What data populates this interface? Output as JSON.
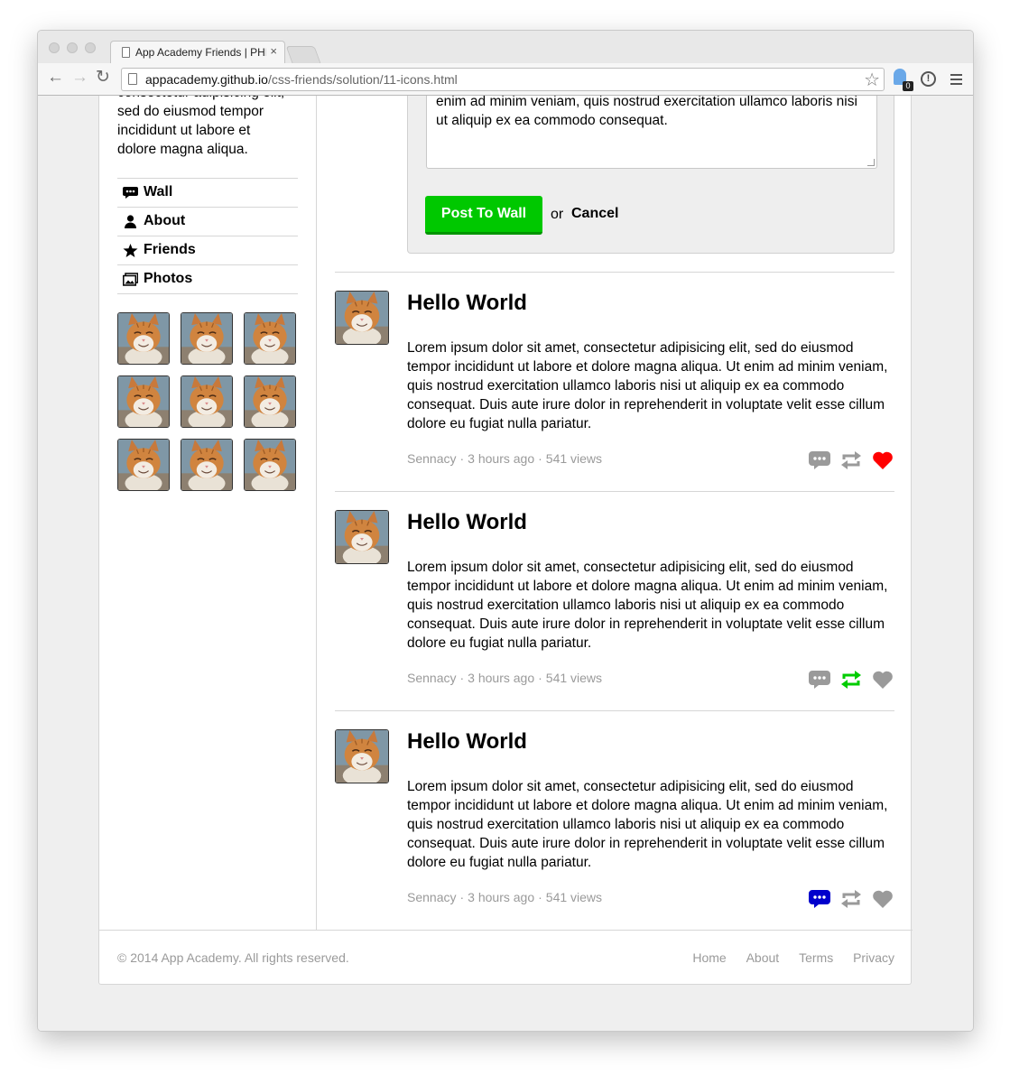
{
  "browser": {
    "tab_title": "App Academy Friends | PHP",
    "tab_close": "×",
    "url_host": "appacademy.github.io",
    "url_path": "/css-friends/solution/11-icons.html",
    "extension_badge": "0"
  },
  "sidebar": {
    "bio": "consectetur adipisicing elit, sed do eiusmod tempor incididunt ut labore et dolore magna aliqua.",
    "nav": [
      {
        "label": "Wall",
        "icon": "speech-bubble-icon"
      },
      {
        "label": "About",
        "icon": "person-icon"
      },
      {
        "label": "Friends",
        "icon": "star-icon"
      },
      {
        "label": "Photos",
        "icon": "photos-icon"
      }
    ],
    "thumbnail_count": 9
  },
  "composer": {
    "text": "enim ad minim veniam, quis nostrud exercitation ullamco laboris nisi ut aliquip ex ea commodo consequat.",
    "post_button": "Post To Wall",
    "or": "or",
    "cancel": "Cancel"
  },
  "posts": [
    {
      "title": "Hello World",
      "body": "Lorem ipsum dolor sit amet, consectetur adipisicing elit, sed do eiusmod tempor incididunt ut labore et dolore magna aliqua. Ut enim ad minim veniam, quis nostrud exercitation ullamco laboris nisi ut aliquip ex ea commodo consequat. Duis aute irure dolor in reprehenderit in voluptate velit esse cillum dolore eu fugiat nulla pariatur.",
      "author": "Sennacy",
      "time": "3 hours ago",
      "views": "541 views",
      "comment_color": "#9a9a9a",
      "repost_color": "#9a9a9a",
      "like_color": "#ff0000"
    },
    {
      "title": "Hello World",
      "body": "Lorem ipsum dolor sit amet, consectetur adipisicing elit, sed do eiusmod tempor incididunt ut labore et dolore magna aliqua. Ut enim ad minim veniam, quis nostrud exercitation ullamco laboris nisi ut aliquip ex ea commodo consequat. Duis aute irure dolor in reprehenderit in voluptate velit esse cillum dolore eu fugiat nulla pariatur.",
      "author": "Sennacy",
      "time": "3 hours ago",
      "views": "541 views",
      "comment_color": "#9a9a9a",
      "repost_color": "#00cc00",
      "like_color": "#9a9a9a"
    },
    {
      "title": "Hello World",
      "body": "Lorem ipsum dolor sit amet, consectetur adipisicing elit, sed do eiusmod tempor incididunt ut labore et dolore magna aliqua. Ut enim ad minim veniam, quis nostrud exercitation ullamco laboris nisi ut aliquip ex ea commodo consequat. Duis aute irure dolor in reprehenderit in voluptate velit esse cillum dolore eu fugiat nulla pariatur.",
      "author": "Sennacy",
      "time": "3 hours ago",
      "views": "541 views",
      "comment_color": "#0000cc",
      "repost_color": "#9a9a9a",
      "like_color": "#9a9a9a"
    }
  ],
  "footer": {
    "copyright": "© 2014 App Academy. All rights reserved.",
    "links": [
      "Home",
      "About",
      "Terms",
      "Privacy"
    ]
  },
  "colors": {
    "accent_green": "#00c800",
    "muted_text": "#9a9a9a",
    "border": "#d6d6d6"
  }
}
